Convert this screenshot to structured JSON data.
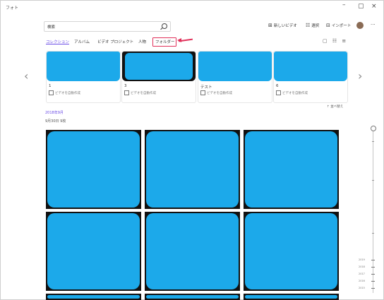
{
  "window": {
    "app_name": "フォト",
    "minimize": "–",
    "maximize": "▢",
    "close": "×"
  },
  "search": {
    "value": "検索"
  },
  "toolbar": {
    "new_video": "新しいビデオ",
    "select": "選択",
    "import": "インポート",
    "more": "···"
  },
  "tabs": [
    {
      "label": "コレクション",
      "active": true
    },
    {
      "label": "アルバム"
    },
    {
      "label": "ビデオ プロジェクト"
    },
    {
      "label": "人物"
    },
    {
      "label": "フォルダー",
      "highlighted": true
    }
  ],
  "view_icons": {
    "filter": "▢",
    "grid": "☷",
    "list": "≡"
  },
  "albums": [
    {
      "title": "1",
      "subtitle": "ビデオを自動作成"
    },
    {
      "title": "3",
      "subtitle": "ビデオを自動作成"
    },
    {
      "title": "テスト",
      "subtitle": "ビデオを自動作成"
    },
    {
      "title": "6",
      "subtitle": "ビデオを自動作成"
    }
  ],
  "nav": {
    "prev": "‹",
    "next": "›"
  },
  "sort_label": "↑ 並べ替え",
  "date_group": {
    "header": "2018年9月",
    "sub": "9月30日  9枚"
  },
  "timeline": {
    "labels": [
      "2019",
      "2018",
      "2017",
      "2016",
      "2015"
    ]
  },
  "colors": {
    "accent": "#6b4ce6",
    "highlight": "#e0305a",
    "photo_fill": "#1ca9ea"
  }
}
